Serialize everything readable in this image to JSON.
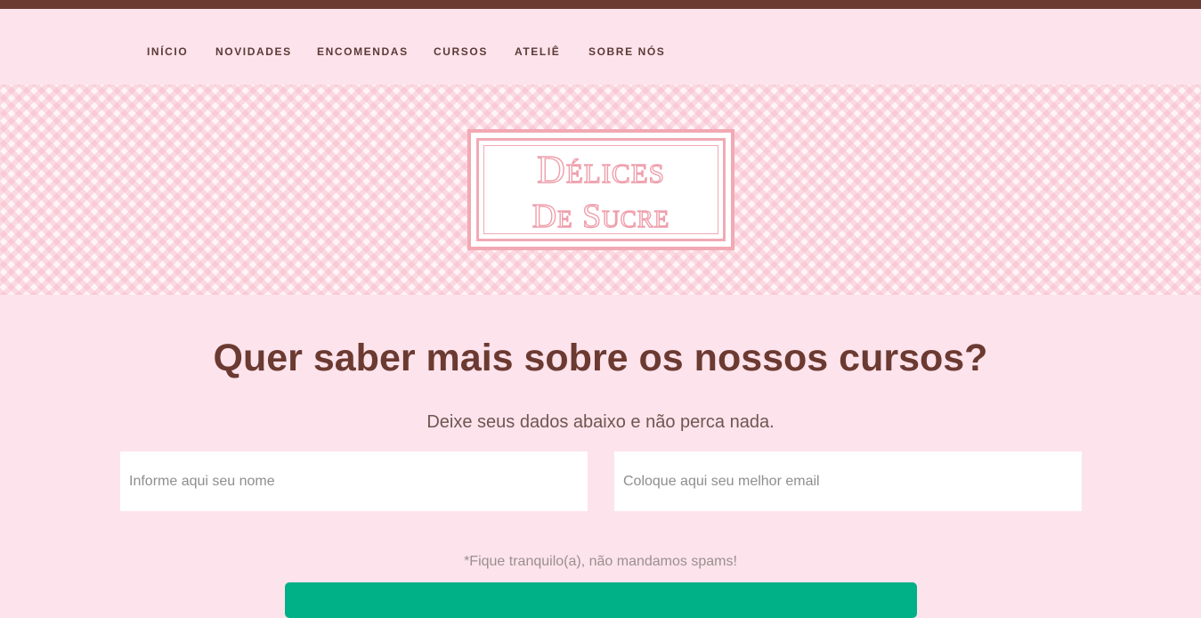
{
  "nav": {
    "items": [
      {
        "label": "INÍCIO"
      },
      {
        "label": "NOVIDADES"
      },
      {
        "label": "ENCOMENDAS"
      },
      {
        "label": "CURSOS"
      },
      {
        "label": "ATELIÊ"
      },
      {
        "label": "SOBRE NÓS"
      }
    ]
  },
  "logo": {
    "line1": "Délices",
    "line2": "De Sucre"
  },
  "signup": {
    "headline": "Quer saber mais sobre os nossos cursos?",
    "subtitle": "Deixe seus dados abaixo e não perca nada.",
    "name_placeholder": "Informe aqui seu nome",
    "email_placeholder": "Coloque aqui seu melhor email",
    "note": "*Fique tranquilo(a), não mandamos spams!"
  },
  "colors": {
    "top_bar": "#6b3a31",
    "background": "#fde3ec",
    "logo_pink": "#f2a9b4",
    "headline": "#6b3a31",
    "button": "#00b087"
  }
}
